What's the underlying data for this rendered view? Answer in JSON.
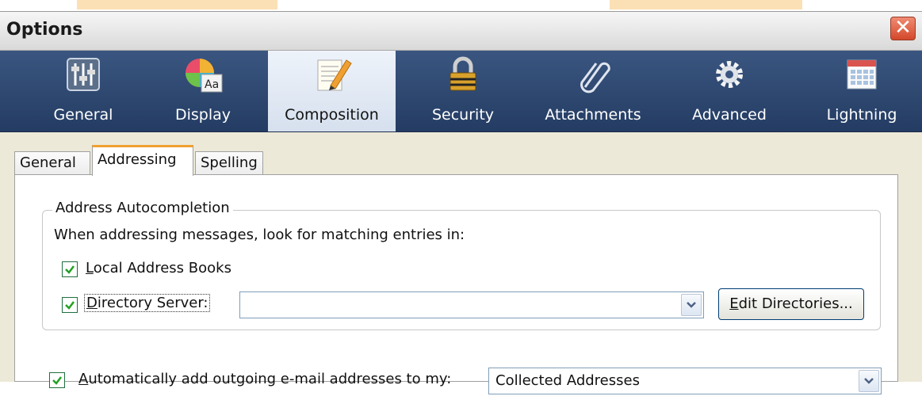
{
  "window": {
    "title": "Options",
    "close_label": "✕"
  },
  "panes": [
    {
      "label": "General",
      "icon": "sliders-icon",
      "selected": false
    },
    {
      "label": "Display",
      "icon": "color-wheel-font-icon",
      "selected": false
    },
    {
      "label": "Composition",
      "icon": "notepad-pencil-icon",
      "selected": true
    },
    {
      "label": "Security",
      "icon": "padlock-icon",
      "selected": false
    },
    {
      "label": "Attachments",
      "icon": "paperclip-icon",
      "selected": false
    },
    {
      "label": "Advanced",
      "icon": "gear-icon",
      "selected": false
    },
    {
      "label": "Lightning",
      "icon": "calendar-icon",
      "selected": false
    }
  ],
  "subtabs": [
    {
      "label": "General",
      "active": false
    },
    {
      "label": "Addressing",
      "active": true
    },
    {
      "label": "Spelling",
      "active": false
    }
  ],
  "autocomplete": {
    "caption": "Address Autocompletion",
    "description": "When addressing messages, look for matching entries in:",
    "local_books": {
      "label_access": "L",
      "label_rest": "ocal Address Books",
      "checked": true
    },
    "directory_server": {
      "label_access": "D",
      "label_rest": "irectory Server:",
      "checked": true,
      "value": ""
    },
    "edit_directories": {
      "label_access": "E",
      "label_rest": "dit Directories..."
    }
  },
  "auto_add": {
    "label_access": "A",
    "label_rest": "utomatically add outgoing e-mail addresses to my:",
    "checked": true,
    "selected_book": "Collected Addresses"
  }
}
